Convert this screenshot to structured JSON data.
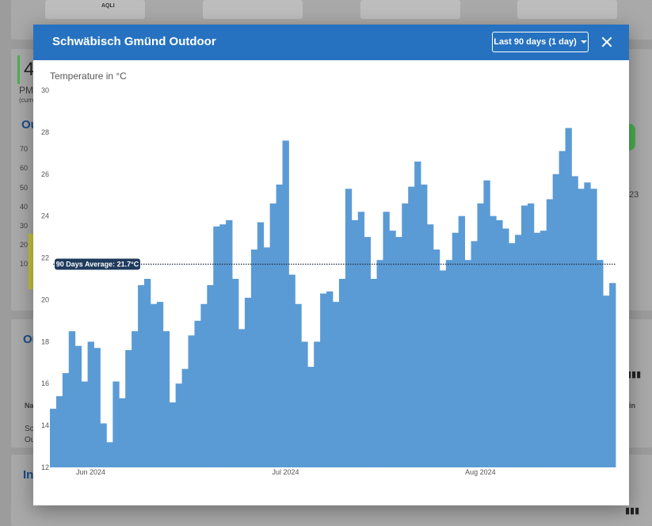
{
  "modal": {
    "title": "Schwäbisch Gmünd Outdoor",
    "range_label": "Last 90 days (1 day)"
  },
  "background": {
    "aqli": "AQLI",
    "pm_label": "PM",
    "current_label": "(curre",
    "section_out": "Ou",
    "section_in": "In",
    "section_out2": "Ou",
    "big_number": "4",
    "left_ticks": [
      "70",
      "60",
      "50",
      "40",
      "30",
      "20",
      "10"
    ],
    "na_label": "Na",
    "sc_label": "Sc",
    "ou_label": "Ou",
    "right_23": "23",
    "right_in": "in"
  },
  "chart_data": {
    "type": "bar",
    "title": "Temperature in °C",
    "ylim": [
      12,
      30
    ],
    "yticks": [
      "12",
      "14",
      "16",
      "18",
      "20",
      "22",
      "24",
      "26",
      "28",
      "30"
    ],
    "xticks": [
      {
        "label": "Jun 2024",
        "index": 6
      },
      {
        "label": "Jul 2024",
        "index": 37
      },
      {
        "label": "Aug 2024",
        "index": 68
      }
    ],
    "average": 21.7,
    "average_label": "90 Days Average: 21.7°C",
    "color": "#5b9bd5",
    "values": [
      14.8,
      15.4,
      16.5,
      18.5,
      17.8,
      16.1,
      18.0,
      17.7,
      14.1,
      13.2,
      16.1,
      15.3,
      17.6,
      18.5,
      20.7,
      21.0,
      19.8,
      19.9,
      18.5,
      15.1,
      16.0,
      16.7,
      18.3,
      19.0,
      19.8,
      20.7,
      23.5,
      23.6,
      23.8,
      21.0,
      18.6,
      20.1,
      22.4,
      23.7,
      22.5,
      24.6,
      25.5,
      27.6,
      21.2,
      19.8,
      18.0,
      16.8,
      18.0,
      20.3,
      20.4,
      19.9,
      21.0,
      25.3,
      23.8,
      24.2,
      23.0,
      21.0,
      21.9,
      24.2,
      23.3,
      23.0,
      24.6,
      25.4,
      26.6,
      25.5,
      23.6,
      22.4,
      21.4,
      21.9,
      23.2,
      24.0,
      21.9,
      22.8,
      24.6,
      25.7,
      24.0,
      23.8,
      23.4,
      22.7,
      23.1,
      24.5,
      24.6,
      23.2,
      23.3,
      24.8,
      26.0,
      27.1,
      28.2,
      25.9,
      25.3,
      25.6,
      25.3,
      21.9,
      20.2,
      20.8
    ]
  }
}
